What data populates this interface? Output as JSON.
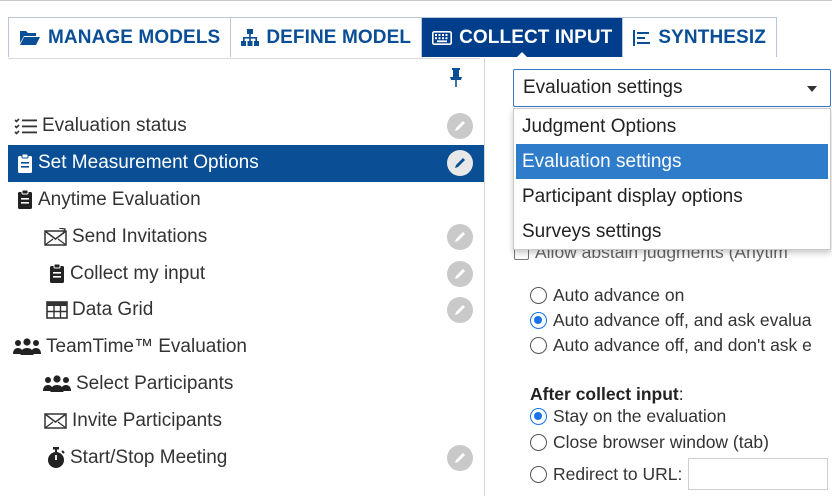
{
  "tabs": [
    {
      "label": "MANAGE MODELS",
      "icon": "folder-open-icon",
      "active": false
    },
    {
      "label": "DEFINE MODEL",
      "icon": "hierarchy-icon",
      "active": false
    },
    {
      "label": "COLLECT INPUT",
      "icon": "keyboard-icon",
      "active": true
    },
    {
      "label": "SYNTHESIZ",
      "icon": "align-left-icon",
      "active": false
    }
  ],
  "sidebar": {
    "items": [
      {
        "label": "Evaluation status",
        "icon": "checklist-icon",
        "level": 0,
        "selected": false,
        "badge": true
      },
      {
        "label": "Set Measurement Options",
        "icon": "clipboard-icon",
        "level": 0,
        "selected": true,
        "badge": true
      },
      {
        "label": "Anytime Evaluation",
        "icon": "clipboard-icon",
        "level": 0,
        "selected": false,
        "badge": false
      },
      {
        "label": "Send Invitations",
        "icon": "envelope-send-icon",
        "level": 1,
        "selected": false,
        "badge": true
      },
      {
        "label": "Collect my input",
        "icon": "clipboard-icon",
        "level": 1,
        "selected": false,
        "badge": true
      },
      {
        "label": "Data Grid",
        "icon": "table-icon",
        "level": 1,
        "selected": false,
        "badge": true
      },
      {
        "label": "TeamTime™ Evaluation",
        "icon": "users-icon",
        "level": 0,
        "selected": false,
        "badge": false
      },
      {
        "label": "Select Participants",
        "icon": "users-icon",
        "level": 1,
        "selected": false,
        "badge": false
      },
      {
        "label": "Invite Participants",
        "icon": "envelope-icon",
        "level": 1,
        "selected": false,
        "badge": false
      },
      {
        "label": "Start/Stop Meeting",
        "icon": "stopwatch-icon",
        "level": 1,
        "selected": false,
        "badge": true
      }
    ]
  },
  "settings": {
    "dropdown_value": "Evaluation settings",
    "options": [
      "Judgment Options",
      "Evaluation settings",
      "Participant display options",
      "Surveys settings"
    ],
    "highlighted_option": "Evaluation settings",
    "obscured_checkbox_label": "Allow abstain judgments (Anytim",
    "auto_advance": [
      {
        "label": "Auto advance on",
        "checked": false
      },
      {
        "label": "Auto advance off, and ask evalua",
        "checked": true
      },
      {
        "label": "Auto advance off, and don't ask e",
        "checked": false
      }
    ],
    "after_collect_heading": "After collect input",
    "after_collect_suffix": ":",
    "after_collect": [
      {
        "label": "Stay on the evaluation",
        "checked": true
      },
      {
        "label": "Close browser window (tab)",
        "checked": false
      },
      {
        "label": "Redirect to URL:",
        "checked": false
      }
    ],
    "url_value": ""
  },
  "colors": {
    "brand": "#003e8c",
    "selection": "#0a4f96",
    "menu_highlight": "#2f7ccb",
    "radio_on": "#1a73e8",
    "badge": "#c9c9c9"
  }
}
